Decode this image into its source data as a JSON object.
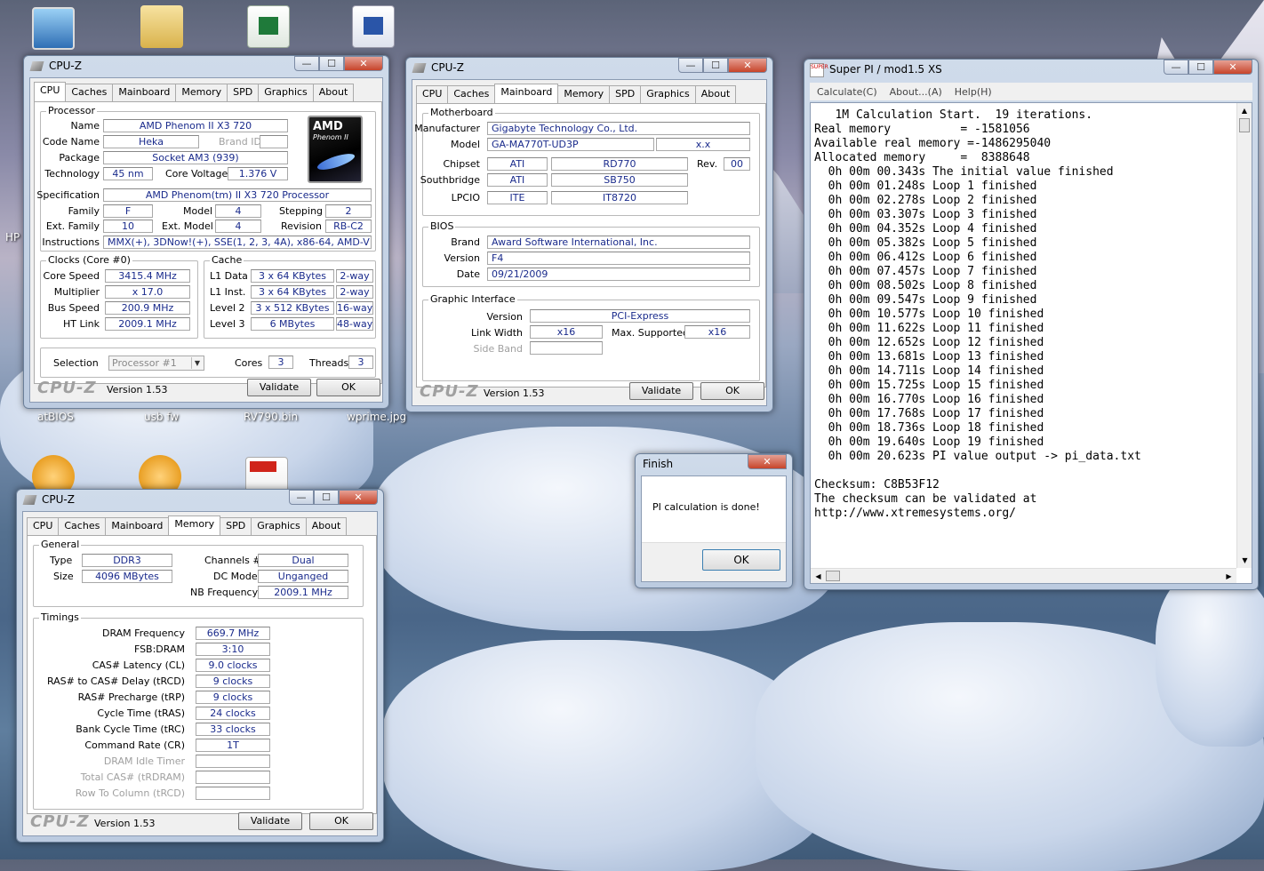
{
  "desktop": {
    "icons": [
      {
        "label": "atBIOS"
      },
      {
        "label": "usb fw"
      },
      {
        "label": "RV790.bin"
      },
      {
        "label": "wprime.jpg"
      },
      {
        "label": "HP"
      }
    ]
  },
  "cpuz_cpu": {
    "title": "CPU-Z",
    "tabs": [
      "CPU",
      "Caches",
      "Mainboard",
      "Memory",
      "SPD",
      "Graphics",
      "About"
    ],
    "processor": {
      "group": "Processor",
      "name_label": "Name",
      "name": "AMD Phenom II X3 720",
      "codename_label": "Code Name",
      "codename": "Heka",
      "brandid_label": "Brand ID",
      "package_label": "Package",
      "package": "Socket AM3 (939)",
      "technology_label": "Technology",
      "technology": "45 nm",
      "corevoltage_label": "Core Voltage",
      "corevoltage": "1.376 V",
      "spec_label": "Specification",
      "spec": "AMD Phenom(tm) II X3 720 Processor",
      "family_label": "Family",
      "family": "F",
      "model_label": "Model",
      "model": "4",
      "stepping_label": "Stepping",
      "stepping": "2",
      "extfamily_label": "Ext. Family",
      "extfamily": "10",
      "extmodel_label": "Ext. Model",
      "extmodel": "4",
      "revision_label": "Revision",
      "revision": "RB-C2",
      "instr_label": "Instructions",
      "instr": "MMX(+), 3DNow!(+), SSE(1, 2, 3, 4A), x86-64, AMD-V",
      "logo_brand": "AMD",
      "logo_line": "Phenom II"
    },
    "clocks": {
      "group": "Clocks (Core #0)",
      "corespeed_label": "Core Speed",
      "corespeed": "3415.4 MHz",
      "multiplier_label": "Multiplier",
      "multiplier": "x 17.0",
      "busspeed_label": "Bus Speed",
      "busspeed": "200.9 MHz",
      "htlink_label": "HT Link",
      "htlink": "2009.1 MHz"
    },
    "cache": {
      "group": "Cache",
      "rows": [
        {
          "label": "L1 Data",
          "size": "3 x 64 KBytes",
          "way": "2-way"
        },
        {
          "label": "L1 Inst.",
          "size": "3 x 64 KBytes",
          "way": "2-way"
        },
        {
          "label": "Level 2",
          "size": "3 x 512 KBytes",
          "way": "16-way"
        },
        {
          "label": "Level 3",
          "size": "6 MBytes",
          "way": "48-way"
        }
      ]
    },
    "selection_label": "Selection",
    "selection": "Processor #1",
    "cores_label": "Cores",
    "cores": "3",
    "threads_label": "Threads",
    "threads": "3",
    "logo": "CPU-Z",
    "version": "Version 1.53",
    "validate": "Validate",
    "ok": "OK"
  },
  "cpuz_mb": {
    "title": "CPU-Z",
    "tabs": [
      "CPU",
      "Caches",
      "Mainboard",
      "Memory",
      "SPD",
      "Graphics",
      "About"
    ],
    "mb_group": "Motherboard",
    "manufacturer_label": "Manufacturer",
    "manufacturer": "Gigabyte Technology Co., Ltd.",
    "model_label": "Model",
    "model": "GA-MA770T-UD3P",
    "model_rev": "x.x",
    "chipset_label": "Chipset",
    "chipset_vendor": "ATI",
    "chipset": "RD770",
    "rev_label": "Rev.",
    "rev": "00",
    "south_label": "Southbridge",
    "south_vendor": "ATI",
    "south": "SB750",
    "lpcio_label": "LPCIO",
    "lpcio_vendor": "ITE",
    "lpcio": "IT8720",
    "bios_group": "BIOS",
    "brand_label": "Brand",
    "brand": "Award Software International, Inc.",
    "version_label": "Version",
    "version_val": "F4",
    "date_label": "Date",
    "date": "09/21/2009",
    "gi_group": "Graphic Interface",
    "giver_label": "Version",
    "giver": "PCI-Express",
    "lw_label": "Link Width",
    "lw": "x16",
    "ms_label": "Max. Supported",
    "ms": "x16",
    "sb_label": "Side Band",
    "logo": "CPU-Z",
    "version": "Version 1.53",
    "validate": "Validate",
    "ok": "OK"
  },
  "cpuz_mem": {
    "title": "CPU-Z",
    "tabs": [
      "CPU",
      "Caches",
      "Mainboard",
      "Memory",
      "SPD",
      "Graphics",
      "About"
    ],
    "gen_group": "General",
    "type_label": "Type",
    "type": "DDR3",
    "size_label": "Size",
    "size": "4096 MBytes",
    "channels_label": "Channels #",
    "channels": "Dual",
    "dcmode_label": "DC Mode",
    "dcmode": "Unganged",
    "nbfreq_label": "NB Frequency",
    "nbfreq": "2009.1 MHz",
    "tim_group": "Timings",
    "timings": [
      {
        "label": "DRAM Frequency",
        "value": "669.7 MHz"
      },
      {
        "label": "FSB:DRAM",
        "value": "3:10"
      },
      {
        "label": "CAS# Latency (CL)",
        "value": "9.0 clocks"
      },
      {
        "label": "RAS# to CAS# Delay (tRCD)",
        "value": "9 clocks"
      },
      {
        "label": "RAS# Precharge (tRP)",
        "value": "9 clocks"
      },
      {
        "label": "Cycle Time (tRAS)",
        "value": "24 clocks"
      },
      {
        "label": "Bank Cycle Time (tRC)",
        "value": "33 clocks"
      },
      {
        "label": "Command Rate (CR)",
        "value": "1T"
      },
      {
        "label": "DRAM Idle Timer",
        "value": ""
      },
      {
        "label": "Total CAS# (tRDRAM)",
        "value": ""
      },
      {
        "label": "Row To Column (tRCD)",
        "value": ""
      }
    ],
    "logo": "CPU-Z",
    "version": "Version 1.53",
    "validate": "Validate",
    "ok": "OK"
  },
  "finish": {
    "title": "Finish",
    "close": "✕",
    "message": "PI calculation is done!",
    "ok": "OK"
  },
  "superpi": {
    "title": "Super PI / mod1.5 XS",
    "icon_text": "SUPER",
    "menu": [
      "Calculate(C)",
      "About...(A)",
      "Help(H)"
    ],
    "lines": [
      "   1M Calculation Start.  19 iterations.",
      "Real memory          = -1581056",
      "Available real memory =-1486295040",
      "Allocated memory     =  8388648",
      "  0h 00m 00.343s The initial value finished",
      "  0h 00m 01.248s Loop 1 finished",
      "  0h 00m 02.278s Loop 2 finished",
      "  0h 00m 03.307s Loop 3 finished",
      "  0h 00m 04.352s Loop 4 finished",
      "  0h 00m 05.382s Loop 5 finished",
      "  0h 00m 06.412s Loop 6 finished",
      "  0h 00m 07.457s Loop 7 finished",
      "  0h 00m 08.502s Loop 8 finished",
      "  0h 00m 09.547s Loop 9 finished",
      "  0h 00m 10.577s Loop 10 finished",
      "  0h 00m 11.622s Loop 11 finished",
      "  0h 00m 12.652s Loop 12 finished",
      "  0h 00m 13.681s Loop 13 finished",
      "  0h 00m 14.711s Loop 14 finished",
      "  0h 00m 15.725s Loop 15 finished",
      "  0h 00m 16.770s Loop 16 finished",
      "  0h 00m 17.768s Loop 17 finished",
      "  0h 00m 18.736s Loop 18 finished",
      "  0h 00m 19.640s Loop 19 finished",
      "  0h 00m 20.623s PI value output -> pi_data.txt",
      "",
      "Checksum: C8B53F12",
      "The checksum can be validated at",
      "http://www.xtremesystems.org/"
    ]
  },
  "window_controls": {
    "min": "—",
    "max": "☐",
    "close": "✕"
  }
}
